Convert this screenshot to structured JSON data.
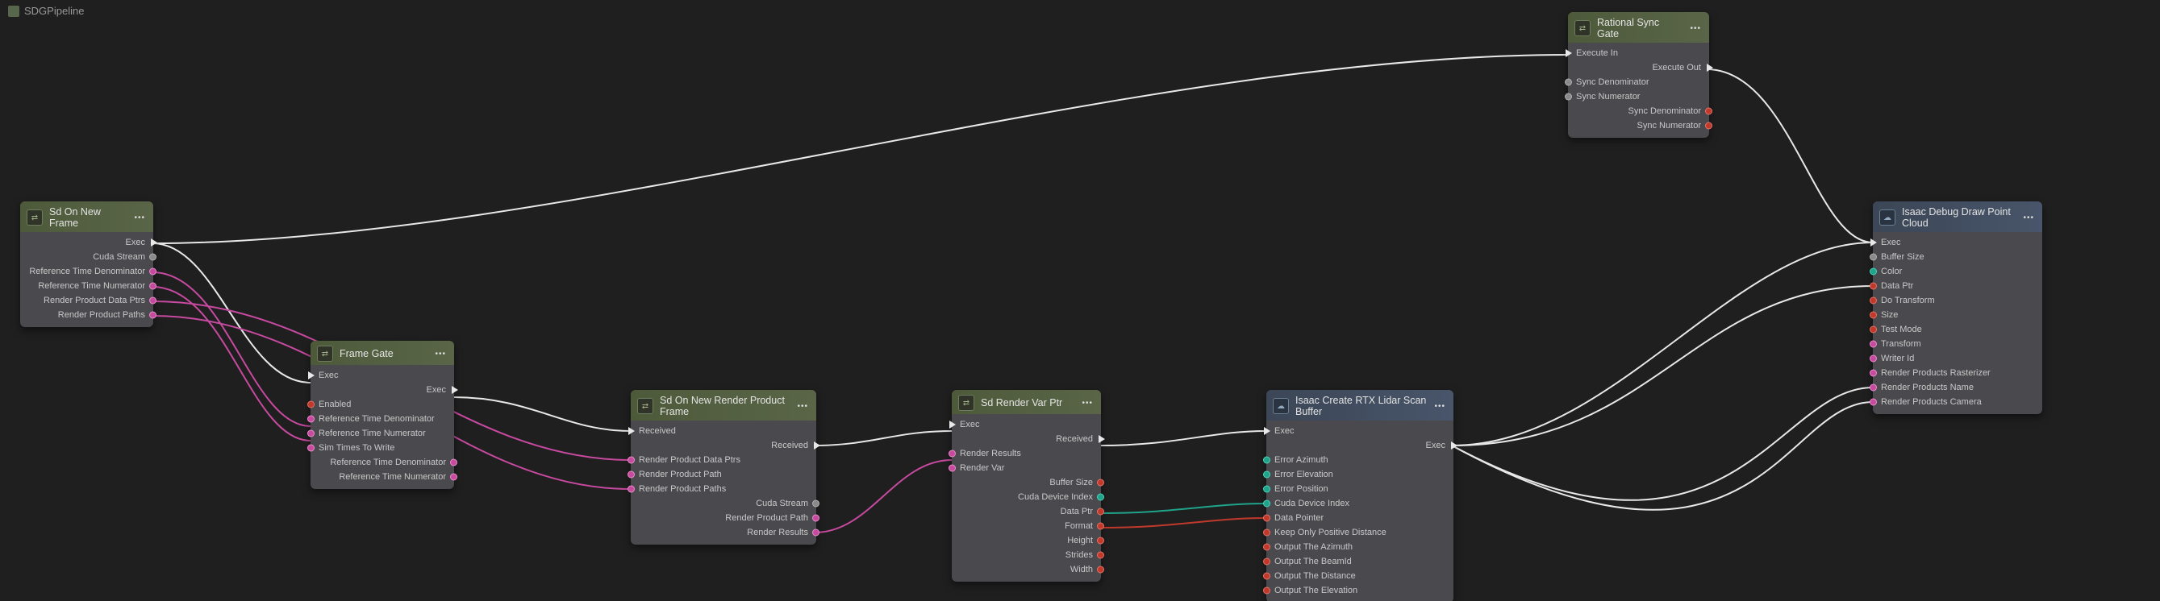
{
  "breadcrumb": "SDGPipeline",
  "nodes": {
    "sd_on_new_frame": {
      "title": "Sd On New Frame",
      "outputs": {
        "exec": "Exec",
        "cuda_stream": "Cuda Stream",
        "ref_time_denom": "Reference Time Denominator",
        "ref_time_numer": "Reference Time Numerator",
        "render_product_data_ptrs": "Render Product Data Ptrs",
        "render_product_paths": "Render Product Paths"
      }
    },
    "frame_gate": {
      "title": "Frame Gate",
      "inputs": {
        "exec": "Exec",
        "enabled": "Enabled",
        "ref_time_denom": "Reference Time Denominator",
        "ref_time_numer": "Reference Time Numerator",
        "sim_times_to_write": "Sim Times To Write"
      },
      "outputs": {
        "exec": "Exec",
        "ref_time_denom": "Reference Time Denominator",
        "ref_time_numer": "Reference Time Numerator"
      }
    },
    "rational_sync_gate": {
      "title": "Rational Sync Gate",
      "inputs": {
        "execute_in": "Execute In",
        "sync_denom": "Sync Denominator",
        "sync_numer": "Sync Numerator"
      },
      "outputs": {
        "execute_out": "Execute Out",
        "sync_denom": "Sync Denominator",
        "sync_numer": "Sync Numerator"
      }
    },
    "sd_on_new_rpf": {
      "title": "Sd On New Render Product Frame",
      "inputs": {
        "received": "Received",
        "render_product_data_ptrs": "Render Product Data Ptrs",
        "render_product_path": "Render Product Path",
        "render_product_paths": "Render Product Paths"
      },
      "outputs": {
        "received": "Received",
        "cuda_stream": "Cuda Stream",
        "render_product_path": "Render Product Path",
        "render_results": "Render Results"
      }
    },
    "sd_render_var_ptr": {
      "title": "Sd Render Var Ptr",
      "inputs": {
        "exec": "Exec",
        "render_results": "Render Results",
        "render_var": "Render Var"
      },
      "outputs": {
        "received": "Received",
        "buffer_size": "Buffer Size",
        "cuda_device_index": "Cuda Device Index",
        "data_ptr": "Data Ptr",
        "format": "Format",
        "height": "Height",
        "strides": "Strides",
        "width": "Width"
      }
    },
    "isaac_create_rtx": {
      "title": "Isaac Create RTX Lidar Scan Buffer",
      "inputs": {
        "exec": "Exec",
        "error_azimuth": "Error Azimuth",
        "error_elevation": "Error Elevation",
        "error_position": "Error Position",
        "cuda_device_index": "Cuda Device Index",
        "data_pointer": "Data Pointer",
        "keep_only_positive_distance": "Keep Only Positive Distance",
        "output_the_azimuth": "Output The Azimuth",
        "output_the_beamid": "Output The BeamId",
        "output_the_distance": "Output The Distance",
        "output_the_elevation": "Output The Elevation"
      },
      "outputs": {
        "exec": "Exec"
      }
    },
    "isaac_debug_draw": {
      "title": "Isaac Debug Draw Point Cloud",
      "inputs": {
        "exec": "Exec",
        "buffer_size": "Buffer Size",
        "color": "Color",
        "data_ptr": "Data Ptr",
        "do_transform": "Do Transform",
        "size": "Size",
        "test_mode": "Test Mode",
        "transform": "Transform",
        "writer_id": "Writer Id",
        "render_products_rasterizer": "Render Products Rasterizer",
        "render_products_name": "Render Products Name",
        "render_products_camera": "Render Products Camera"
      }
    }
  }
}
